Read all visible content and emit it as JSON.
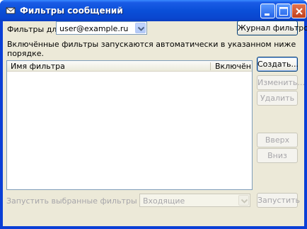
{
  "window": {
    "title": "Фильтры сообщений"
  },
  "filters_for": {
    "label": "Фильтры для:",
    "value": "user@example.ru"
  },
  "buttons": {
    "filter_log": "Журнал фильтров",
    "create": "Создать...",
    "edit": "Изменить...",
    "delete": "Удалить",
    "up": "Вверх",
    "down": "Вниз",
    "run": "Запустить"
  },
  "info_text": {
    "line1": "Включённые фильтры запускаются автоматически в указанном ниже",
    "line2": "порядке."
  },
  "list": {
    "columns": [
      "Имя фильтра",
      "Включён"
    ],
    "rows": []
  },
  "run_in_folder": {
    "label": "Запустить выбранные фильтры в папке:",
    "value": "Входящие"
  },
  "colors": {
    "titlebar": "#0a4fd8",
    "dialog_bg": "#ece9d8",
    "disabled_text": "#a7a6aa"
  },
  "icons": [
    "app-icon",
    "minimize-icon",
    "maximize-icon",
    "close-icon",
    "dropdown-arrow-icon"
  ]
}
